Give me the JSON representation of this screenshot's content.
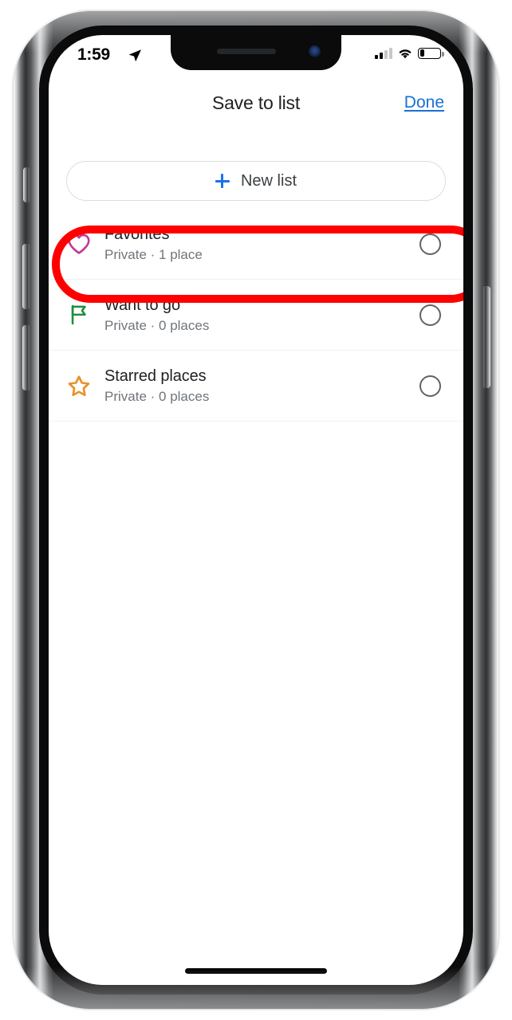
{
  "status_bar": {
    "time": "1:59",
    "location_icon": "location-arrow-icon",
    "cellular_icon": "cellular-bars-icon",
    "cellular_bars_filled": 2,
    "cellular_bars_total": 4,
    "wifi_icon": "wifi-icon",
    "battery_icon": "battery-icon",
    "battery_percent": 25
  },
  "header": {
    "title": "Save to list",
    "done_label": "Done"
  },
  "new_list": {
    "label": "New list",
    "plus_icon": "plus-icon"
  },
  "lists": [
    {
      "title": "Favorites",
      "subtitle": "Private · 1 place",
      "icon": "heart-outline-icon",
      "icon_color": "#c2389a",
      "selected": false,
      "highlighted": true
    },
    {
      "title": "Want to go",
      "subtitle": "Private · 0 places",
      "icon": "flag-outline-icon",
      "icon_color": "#1e8e3e",
      "selected": false,
      "highlighted": false
    },
    {
      "title": "Starred places",
      "subtitle": "Private · 0 places",
      "icon": "star-outline-icon",
      "icon_color": "#e8912a",
      "selected": false,
      "highlighted": false
    }
  ],
  "annotation": {
    "type": "red-highlight-box",
    "color": "#ff0000",
    "targets": "Favorites"
  },
  "home_indicator": "home-indicator-bar"
}
